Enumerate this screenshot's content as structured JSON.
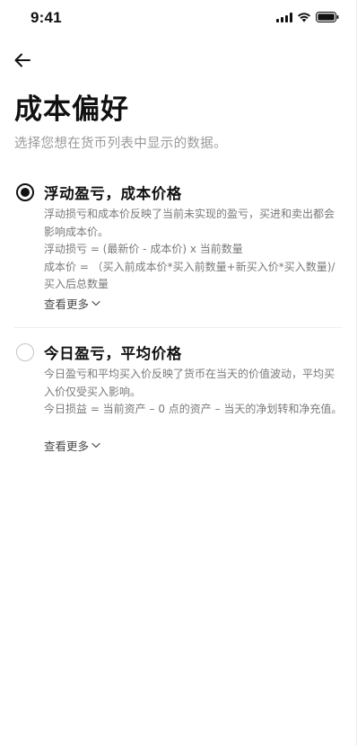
{
  "status_bar": {
    "time": "9:41",
    "icons": [
      "signal-icon",
      "wifi-icon",
      "battery-icon"
    ]
  },
  "header": {
    "back_icon": "arrow-left-icon",
    "title": "成本偏好",
    "subtitle": "选择您想在货币列表中显示的数据。"
  },
  "options": [
    {
      "title": "浮动盈亏，成本价格",
      "selected": true,
      "description": [
        "浮动损亏和成本价反映了当前未实现的盈亏，买进和卖出都会影响成本价。",
        "浮动损亏 = (最新价 - 成本价) x 当前数量",
        "成本价 = （买入前成本价*买入前数量+新买入价*买入数量)/买入后总数量"
      ],
      "see_more": "查看更多"
    },
    {
      "title": "今日盈亏，平均价格",
      "selected": false,
      "description": [
        "今日盈亏和平均买入价反映了货币在当天的价值波动，平均买入价仅受买入影响。",
        "今日损益 = 当前资产 – 0 点的资产 – 当天的净划转和净充值。"
      ],
      "see_more": "查看更多"
    }
  ],
  "colors": {
    "primary_text": "#111111",
    "secondary_text": "#7a7a7a",
    "subtitle_text": "#9a9a9a",
    "divider": "#efefef"
  }
}
